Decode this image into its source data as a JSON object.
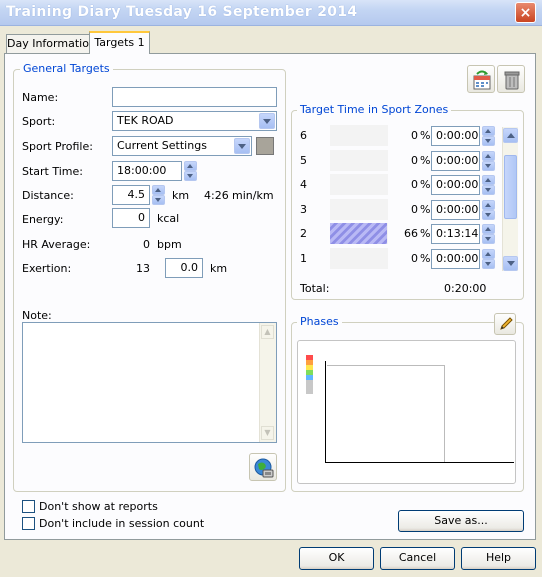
{
  "window": {
    "title": "Training Diary   Tuesday 16 September 2014",
    "close_glyph": "×"
  },
  "tabs": [
    {
      "label": "Day Information"
    },
    {
      "label": "Targets 1",
      "active": true
    }
  ],
  "general": {
    "legend": "General Targets",
    "name_label": "Name:",
    "name_value": "",
    "sport_label": "Sport:",
    "sport_value": "TEK ROAD",
    "profile_label": "Sport Profile:",
    "profile_value": "Current Settings",
    "start_label": "Start Time:",
    "start_value": "18:00:00",
    "distance_label": "Distance:",
    "distance_value": "4.5",
    "distance_unit": "km",
    "pace_value": "4:26",
    "pace_unit": "min/km",
    "energy_label": "Energy:",
    "energy_value": "0",
    "energy_unit": "kcal",
    "hr_label": "HR Average:",
    "hr_value": "0",
    "hr_unit": "bpm",
    "exertion_label": "Exertion:",
    "exertion_value": "13",
    "exertion_km_value": "0.0",
    "exertion_km_unit": "km",
    "note_label": "Note:",
    "note_value": ""
  },
  "zones": {
    "legend": "Target Time in Sport Zones",
    "rows": [
      {
        "zone": "6",
        "percent": "0",
        "time": "0:00:00",
        "fill": 0
      },
      {
        "zone": "5",
        "percent": "0",
        "time": "0:00:00",
        "fill": 0
      },
      {
        "zone": "4",
        "percent": "0",
        "time": "0:00:00",
        "fill": 0
      },
      {
        "zone": "3",
        "percent": "0",
        "time": "0:00:00",
        "fill": 0
      },
      {
        "zone": "2",
        "percent": "66",
        "time": "0:13:14",
        "fill": 0.66
      },
      {
        "zone": "1",
        "percent": "0",
        "time": "0:00:00",
        "fill": 0
      }
    ],
    "percent_sign": "%",
    "total_label": "Total:",
    "total_value": "0:20:00"
  },
  "phases": {
    "legend": "Phases",
    "zone_colors": [
      "#ff4b4b",
      "#ff9f3f",
      "#ffe64b",
      "#7fdd5a",
      "#5fb6ff",
      "#c8c8c8"
    ]
  },
  "checkboxes": {
    "dont_show_reports": "Don't show at reports",
    "dont_include_count": "Don't include in session count"
  },
  "buttons": {
    "save_as": "Save as...",
    "ok": "OK",
    "cancel": "Cancel",
    "help": "Help"
  },
  "colors": {
    "accent": "#0046d5",
    "title_text": "#ffffff",
    "tab_highlight": "#ffc83c"
  }
}
